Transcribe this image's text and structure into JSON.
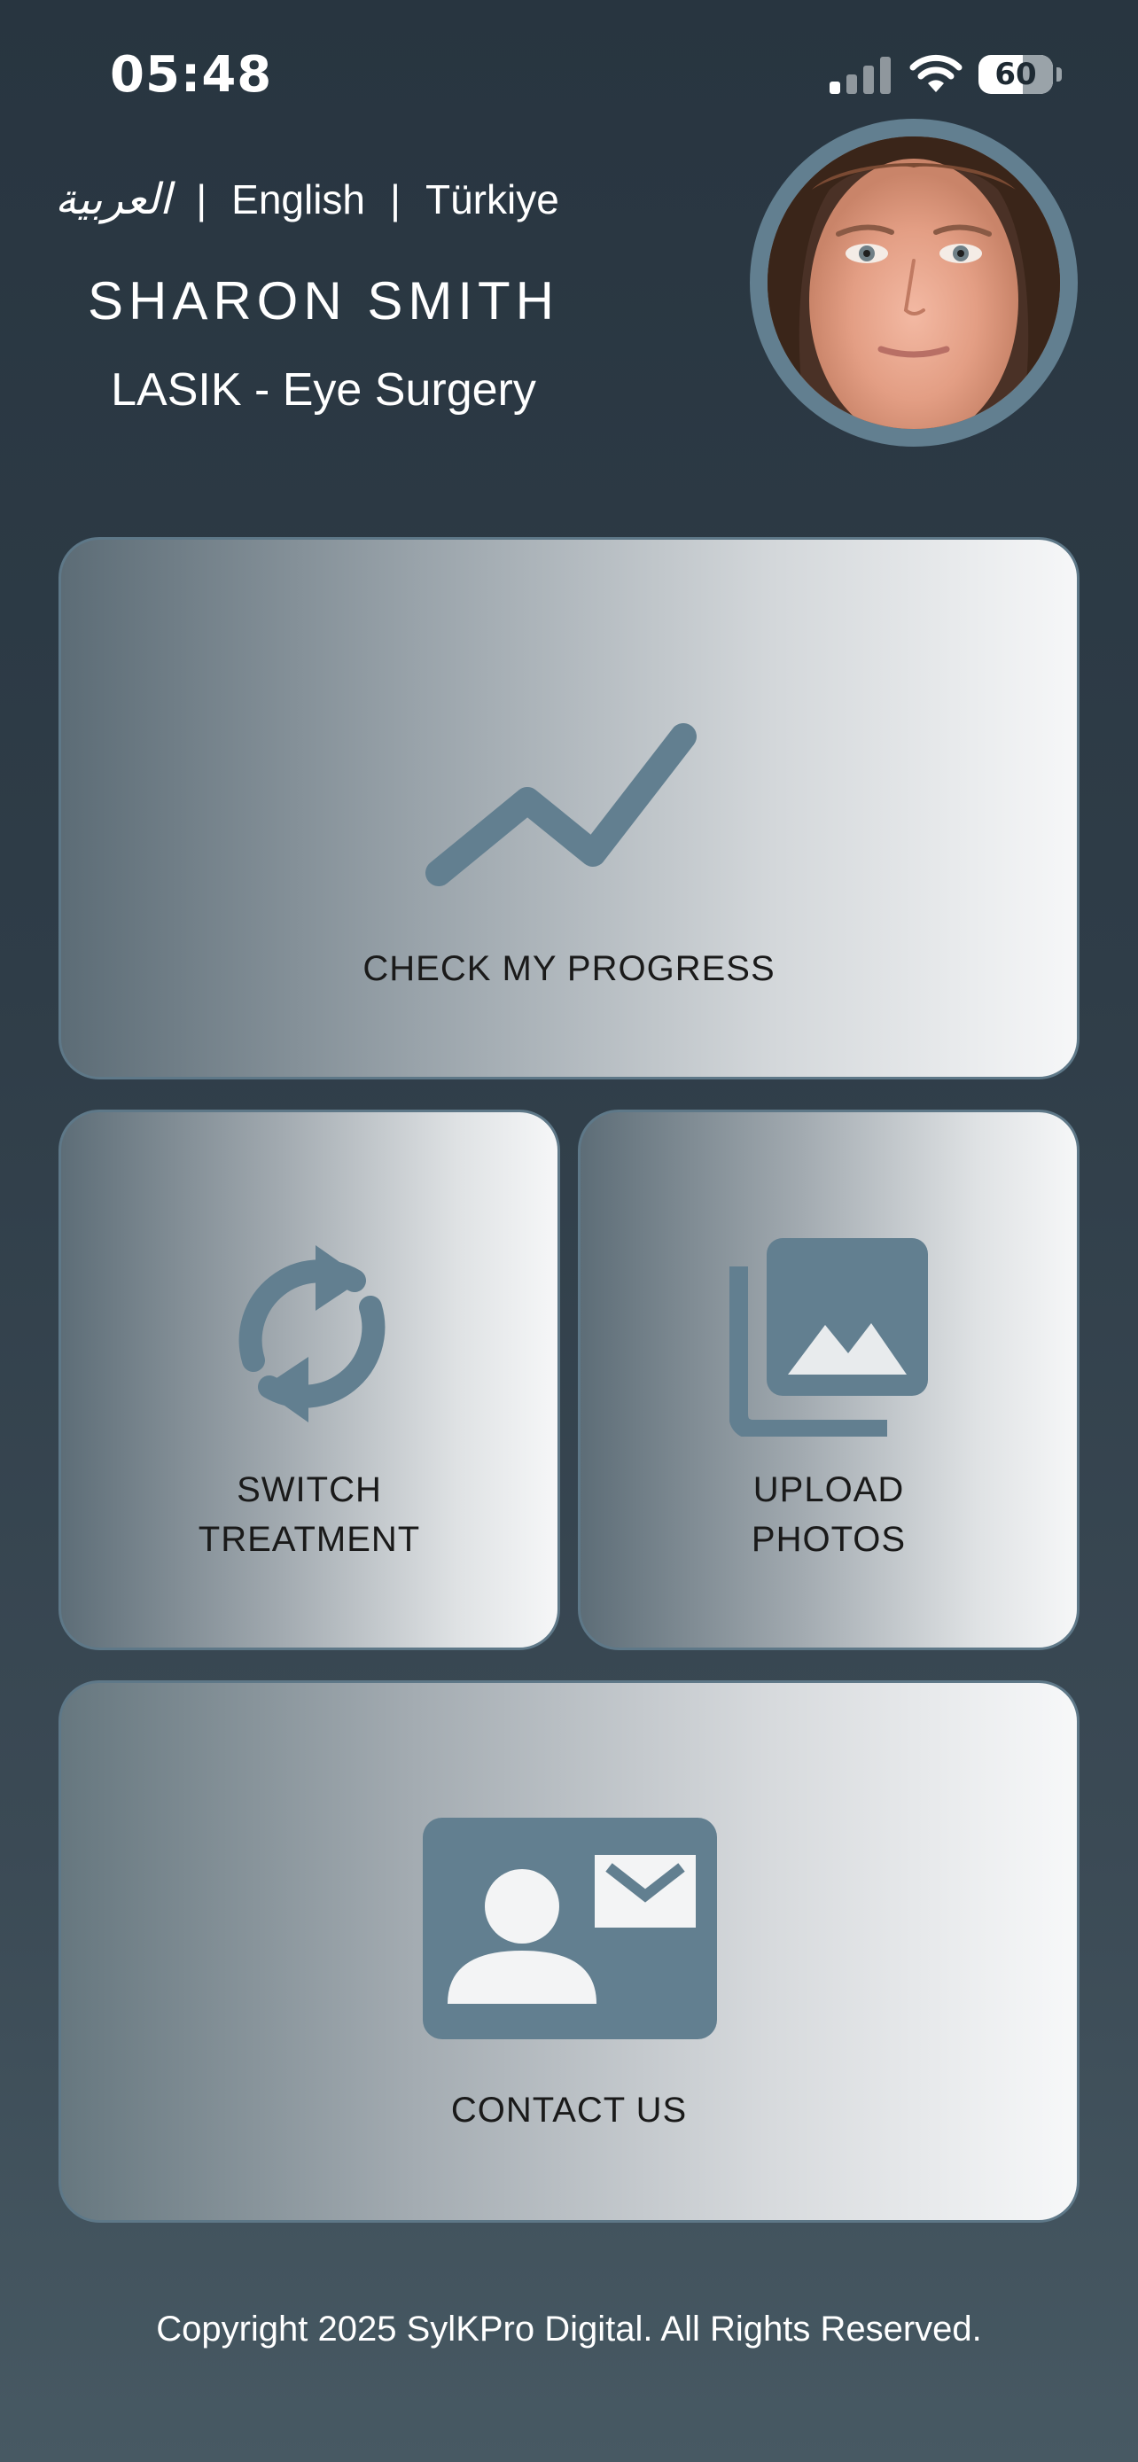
{
  "status_bar": {
    "time": "05:48",
    "battery_level": "60",
    "battery_fraction": 0.6
  },
  "header": {
    "languages": {
      "arabic": "العربية",
      "english": "English",
      "turkish": "Türkiye",
      "separator": "|"
    },
    "patient_name": "SHARON SMITH",
    "procedure": "LASIK - Eye Surgery",
    "avatar": "patient-photo"
  },
  "cards": {
    "progress": {
      "label": "CHECK MY PROGRESS",
      "icon": "trending-up-icon"
    },
    "switch": {
      "label_line1": "SWITCH",
      "label_line2": "TREATMENT",
      "icon": "sync-icon"
    },
    "upload": {
      "label_line1": "UPLOAD",
      "label_line2": "PHOTOS",
      "icon": "photo-library-icon"
    },
    "contact": {
      "label": "CONTACT US",
      "icon": "contact-mail-icon"
    }
  },
  "footer": {
    "copyright": "Copyright 2025 SylKPro Digital. All Rights Reserved."
  },
  "colors": {
    "accent": "#627f90",
    "background_top": "#283540",
    "background_bottom": "#475963"
  }
}
